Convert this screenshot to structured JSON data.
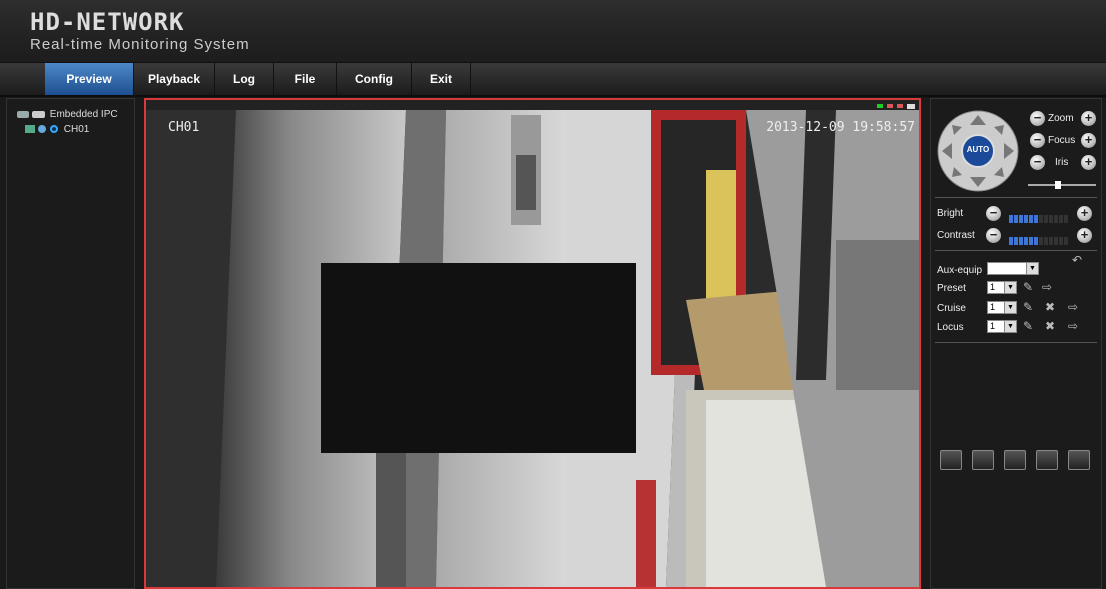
{
  "header": {
    "brand": "HD-NETWORK",
    "subtitle": "Real-time Monitoring System"
  },
  "nav": {
    "tabs": [
      "Preview",
      "Playback",
      "Log",
      "File",
      "Config",
      "Exit"
    ],
    "active": "Preview"
  },
  "tree": {
    "root": "Embedded IPC",
    "channel": "CH01"
  },
  "video": {
    "channel_osd": "CH01",
    "timestamp_osd": "2013-12-09 19:58:57"
  },
  "ptz": {
    "center_label": "AUTO",
    "zoom_label": "Zoom",
    "focus_label": "Focus",
    "iris_label": "Iris",
    "bright_label": "Bright",
    "contrast_label": "Contrast",
    "bright_level": 0.5,
    "contrast_level": 0.5,
    "aux_label": "Aux-equip",
    "preset_label": "Preset",
    "preset_value": "1",
    "cruise_label": "Cruise",
    "cruise_value": "1",
    "locus_label": "Locus",
    "locus_value": "1"
  },
  "colors": {
    "accent": "#1d4f8f",
    "video_border": "#d63a3a",
    "level": "#3d76d8"
  }
}
